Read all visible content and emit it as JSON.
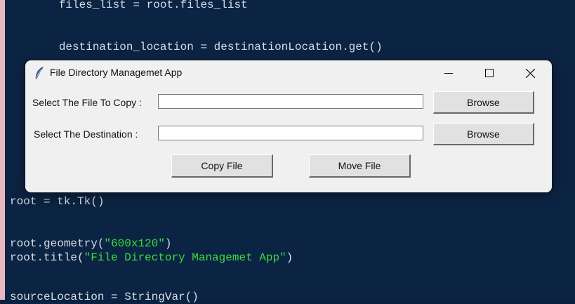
{
  "code": {
    "line1": "        files_list = root.files_list",
    "line2": "        destination_location = destinationLocation.get()",
    "line3": "root = tk.Tk()",
    "line4_pre": "root.geometry(",
    "line4_str": "\"600x120\"",
    "line4_post": ")",
    "line5_pre": "root.title(",
    "line5_str": "\"File Directory Managemet App\"",
    "line5_post": ")",
    "line6": "sourceLocation = StringVar()"
  },
  "window": {
    "title": "File Directory Managemet App",
    "source_label": "Select The File To Copy :",
    "source_value": "",
    "dest_label": "Select The Destination :",
    "dest_value": "",
    "browse_label_1": "Browse",
    "browse_label_2": "Browse",
    "copy_label": "Copy File",
    "move_label": "Move File"
  },
  "icons": {
    "app": "feather-icon",
    "minimize": "minimize-icon",
    "maximize": "maximize-icon",
    "close": "close-icon"
  },
  "colors": {
    "code_bg": "#0c2443",
    "code_text": "#d7dde6",
    "string": "#3ddc3d",
    "window_bg": "#f0f0f0"
  }
}
